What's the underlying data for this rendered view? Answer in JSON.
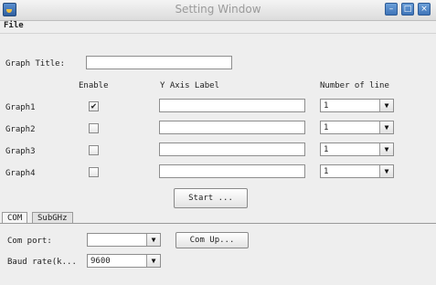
{
  "window": {
    "title": "Setting Window",
    "minimize_glyph": "–",
    "maximize_glyph": "□",
    "close_glyph": "×"
  },
  "menu": {
    "file": "File"
  },
  "graph_title_label": "Graph Title:",
  "graph_title_value": "",
  "columns": {
    "enable": "Enable",
    "y_axis_label": "Y Axis Label",
    "number_of_line": "Number of line"
  },
  "graphs": [
    {
      "label": "Graph1",
      "enabled": true,
      "check_glyph": "✔",
      "y_label": "",
      "lines": "1"
    },
    {
      "label": "Graph2",
      "enabled": false,
      "check_glyph": "",
      "y_label": "",
      "lines": "1"
    },
    {
      "label": "Graph3",
      "enabled": false,
      "check_glyph": "",
      "y_label": "",
      "lines": "1"
    },
    {
      "label": "Graph4",
      "enabled": false,
      "check_glyph": "",
      "y_label": "",
      "lines": "1"
    }
  ],
  "start_button": "Start ...",
  "tabs": [
    {
      "label": "COM",
      "active": true
    },
    {
      "label": "SubGHz",
      "active": false
    }
  ],
  "com": {
    "port_label": "Com port:",
    "port_value": "",
    "com_up_button": "Com Up...",
    "baud_label": "Baud rate(k...",
    "baud_value": "9600"
  },
  "icons": {
    "dropdown": "arrow-down-icon",
    "app": "java-app-icon"
  }
}
